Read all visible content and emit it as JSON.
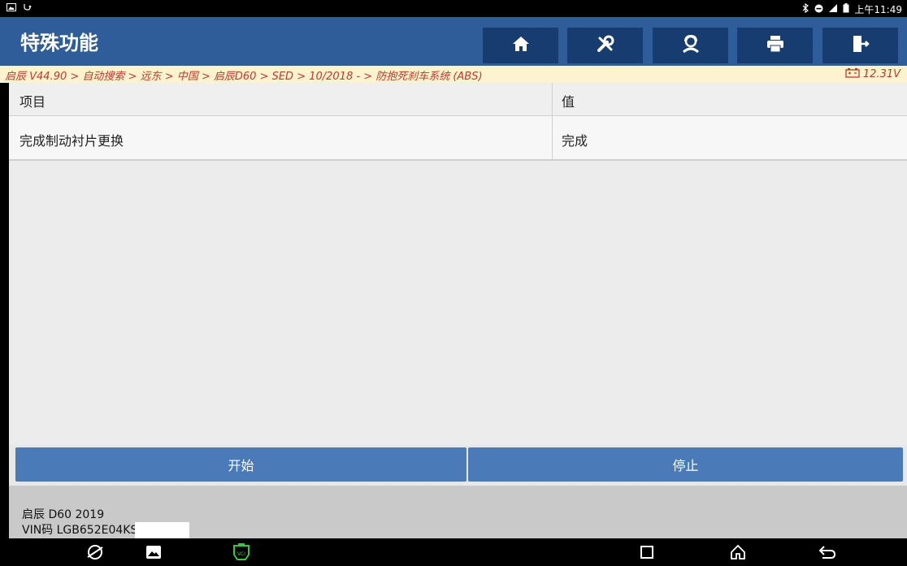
{
  "status_bar": {
    "time": "上午11:49"
  },
  "header": {
    "title": "特殊功能",
    "buttons": [
      {
        "name": "home-button",
        "icon": "home-icon"
      },
      {
        "name": "tools-button",
        "icon": "tools-icon"
      },
      {
        "name": "support-button",
        "icon": "headset-icon"
      },
      {
        "name": "print-button",
        "icon": "printer-icon"
      },
      {
        "name": "exit-button",
        "icon": "exit-icon"
      }
    ]
  },
  "breadcrumb": {
    "path": "启辰 V44.90 > 自动搜索 > 远东 > 中国 > 启辰D60 > SED > 10/2018 - > 防抱死刹车系统 (ABS)",
    "voltage": "12.31V"
  },
  "table": {
    "headers": [
      "项目",
      "值"
    ],
    "rows": [
      [
        "完成制动衬片更换",
        "完成"
      ]
    ]
  },
  "actions": {
    "start": "开始",
    "stop": "停止"
  },
  "footer": {
    "vehicle": "启辰 D60 2019",
    "vin": "VIN码 LGB652E04KS"
  },
  "colors": {
    "header_bg": "#2f5d9a",
    "nav_button_bg": "#163c70",
    "breadcrumb_text": "#c0392b",
    "action_button_bg": "#4a7ab8"
  }
}
